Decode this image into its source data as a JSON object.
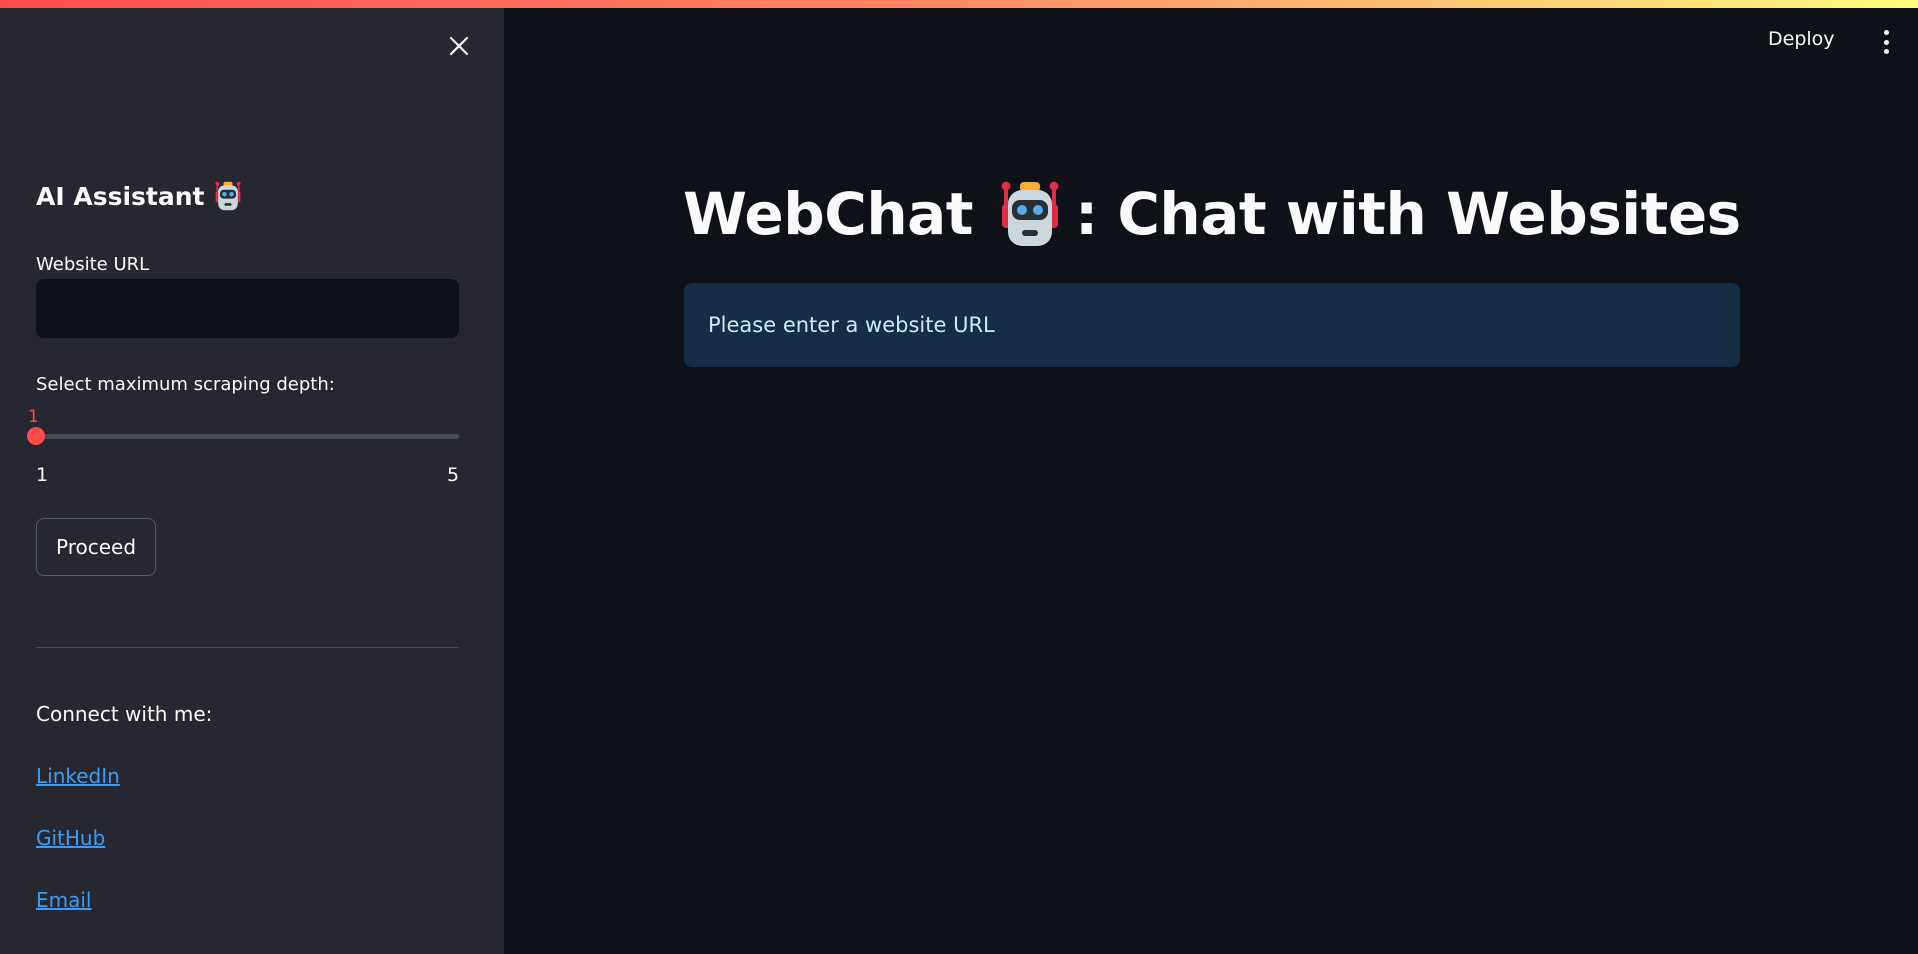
{
  "colors": {
    "background": "#0e1117",
    "sidebar": "#262730",
    "accent": "#ff4b4b",
    "link": "#3d9df3",
    "info_bg": "#172d43",
    "info_text": "#c7ebff"
  },
  "header": {
    "deploy_label": "Deploy",
    "menu_icon": "kebab-menu-icon"
  },
  "sidebar": {
    "close_icon": "close-icon",
    "title": "AI Assistant",
    "title_icon": "robot-icon",
    "url_label": "Website URL",
    "url_value": "",
    "depth_label": "Select maximum scraping depth:",
    "depth_value": "1",
    "depth_min": "1",
    "depth_max": "5",
    "proceed_label": "Proceed",
    "connect_label": "Connect with me:",
    "links": [
      {
        "label": "LinkedIn"
      },
      {
        "label": "GitHub"
      },
      {
        "label": "Email"
      }
    ]
  },
  "main": {
    "title_part1": "WebChat",
    "title_icon": "robot-icon",
    "title_part2": ": Chat with Websites",
    "info_message": "Please enter a website URL"
  }
}
